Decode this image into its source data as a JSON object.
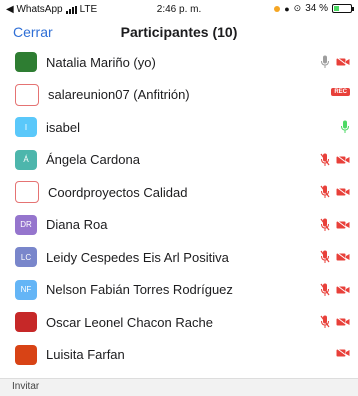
{
  "status_bar": {
    "back_app": "◀ WhatsApp",
    "network": "LTE",
    "time": "2:46 p. m.",
    "battery_text": "34 %",
    "battery_level": 0.34
  },
  "header": {
    "close_label": "Cerrar",
    "title": "Participantes (10)"
  },
  "participants": [
    {
      "name": "Natalia Mariño (yo)",
      "avatar_color": "#2e7d32",
      "avatar_text": "",
      "mic": "gray",
      "cam": "red"
    },
    {
      "name": "salareunion07 (Anfitrión)",
      "avatar_color": "#ffffff",
      "avatar_text": "",
      "mic": "none",
      "cam": "rec"
    },
    {
      "name": "isabel",
      "avatar_color": "#5ac8fa",
      "avatar_text": "I",
      "mic": "green",
      "cam": "none"
    },
    {
      "name": "Ángela Cardona",
      "avatar_color": "#4db6ac",
      "avatar_text": "Á",
      "mic": "red",
      "cam": "red"
    },
    {
      "name": "Coordproyectos Calidad",
      "avatar_color": "#ffffff",
      "avatar_text": "",
      "mic": "red",
      "cam": "red"
    },
    {
      "name": "Diana Roa",
      "avatar_color": "#9575cd",
      "avatar_text": "DR",
      "mic": "red",
      "cam": "red"
    },
    {
      "name": "Leidy Cespedes Eis Arl Positiva",
      "avatar_color": "#7986cb",
      "avatar_text": "LC",
      "mic": "red",
      "cam": "red"
    },
    {
      "name": "Nelson Fabián Torres Rodríguez",
      "avatar_color": "#64b5f6",
      "avatar_text": "NF",
      "mic": "red",
      "cam": "red"
    },
    {
      "name": "Oscar Leonel Chacon Rache",
      "avatar_color": "#c62828",
      "avatar_text": "",
      "mic": "red",
      "cam": "red"
    },
    {
      "name": "Luisita Farfan",
      "avatar_color": "#d84315",
      "avatar_text": "",
      "mic": "none",
      "cam": "red"
    }
  ],
  "footer": {
    "invite_label": "Invitar",
    "rec_label": "REC"
  },
  "colors": {
    "accent": "#2f6fd6",
    "muted_red": "#e8403a",
    "mic_green": "#4cd964",
    "mic_gray": "#9e9e9e"
  },
  "icons": {
    "mic": "microphone-icon",
    "cam": "video-camera-icon",
    "signal": "signal-bars-icon",
    "battery": "battery-icon"
  }
}
